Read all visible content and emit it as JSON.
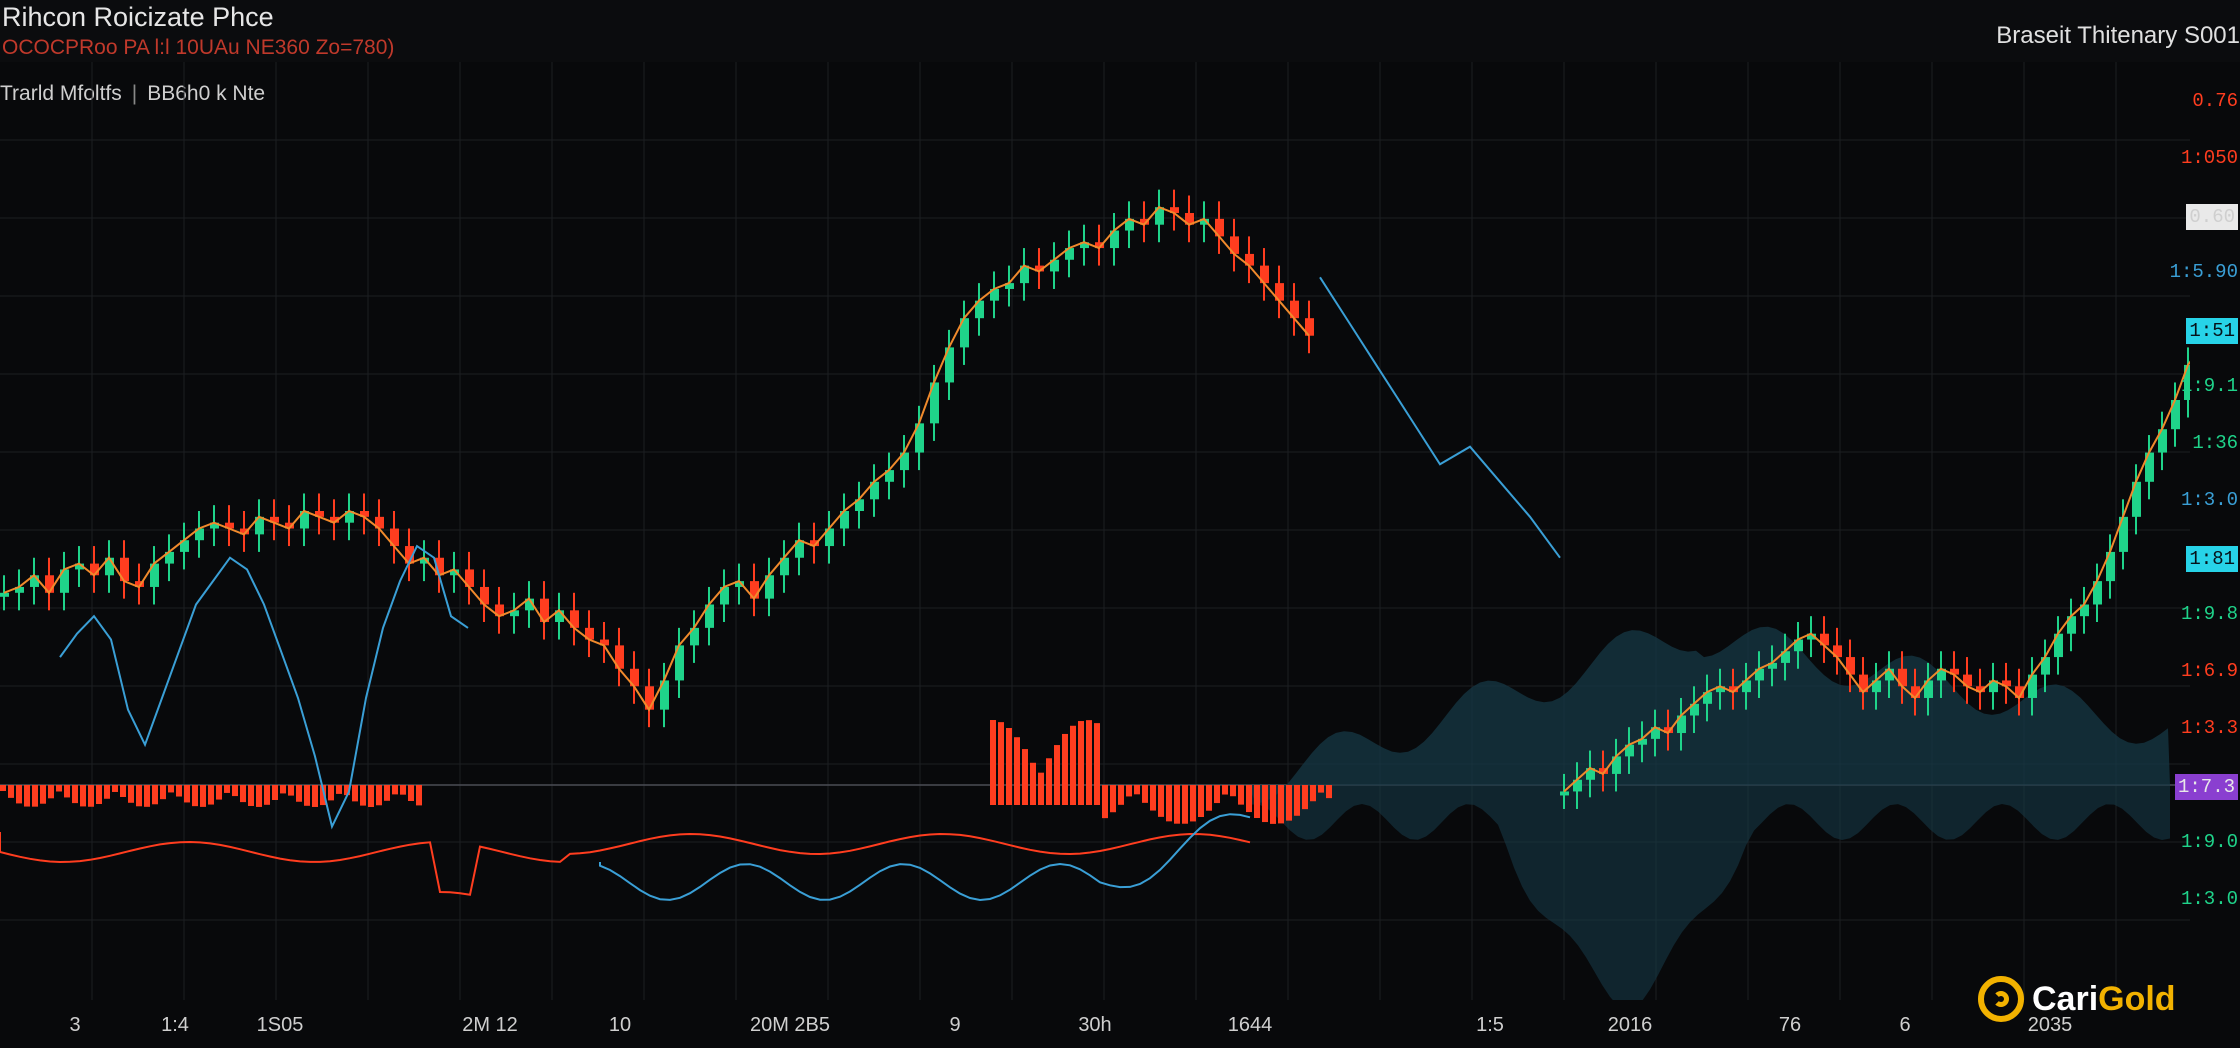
{
  "header": {
    "title": "Rihcon Roicizate Phce",
    "subtitle": "OCOCPRoo  PA l:l 10UAu  NE360 Zo=780)",
    "broker": "Braseit Thitenary S001"
  },
  "legend": {
    "left": "Trarld Mfoltfs",
    "right": "BB6h0 k Nte"
  },
  "colors": {
    "bull": "#1fd38a",
    "bear": "#ff3d1f",
    "line": "#3a9fd6",
    "area_fill": "#163846",
    "ma": "#f08a2c",
    "grid": "#1c1e22",
    "badge_cyan": "#27d3e8",
    "badge_purple": "#8a3fd0"
  },
  "y_axis": {
    "ticks": [
      {
        "label": "0.76",
        "color": "#ff3d1f",
        "badge": false
      },
      {
        "label": "1:050",
        "color": "#ff3d1f",
        "badge": false
      },
      {
        "label": "0.60",
        "color": "#cfcfcf",
        "badge": true,
        "badge_color": "#e9e9e9"
      },
      {
        "label": "1:5.90",
        "color": "#3a9fd6",
        "badge": false
      },
      {
        "label": "1:51",
        "color": "#06121a",
        "badge": true,
        "badge_color": "#27d3e8"
      },
      {
        "label": "1:9.1",
        "color": "#1fd38a",
        "badge": false
      },
      {
        "label": "1:36",
        "color": "#1fd38a",
        "badge": false
      },
      {
        "label": "1:3.0",
        "color": "#3a9fd6",
        "badge": false
      },
      {
        "label": "1:81",
        "color": "#06121a",
        "badge": true,
        "badge_color": "#27d3e8"
      },
      {
        "label": "1:9.8",
        "color": "#1fd38a",
        "badge": false
      },
      {
        "label": "1:6.9",
        "color": "#ff3d1f",
        "badge": false
      },
      {
        "label": "1:3.3",
        "color": "#ff3d1f",
        "badge": false
      },
      {
        "label": "1:7.3",
        "color": "#e8e8e8",
        "badge": true,
        "badge_color": "#8a3fd0"
      },
      {
        "label": "1:9.0",
        "color": "#1fd38a",
        "badge": false
      },
      {
        "label": "1:3.0",
        "color": "#1fd38a",
        "badge": false
      }
    ]
  },
  "x_axis": {
    "ticks": [
      "3",
      "1:4",
      "1S05",
      "2M 12",
      "10",
      "20M 2B5",
      "9",
      "30h",
      "1644",
      "1:5",
      "2016",
      "76",
      "6",
      "2035"
    ]
  },
  "logo": {
    "brand_a": "Cari",
    "brand_b": "Gold"
  },
  "chart_data": {
    "type": "candlestick",
    "title": "Rihcon Roicizate Phce",
    "series": [
      {
        "kind": "candles",
        "close": [
          1.16,
          1.17,
          1.19,
          1.16,
          1.2,
          1.21,
          1.19,
          1.22,
          1.18,
          1.17,
          1.21,
          1.23,
          1.25,
          1.27,
          1.28,
          1.27,
          1.26,
          1.29,
          1.28,
          1.27,
          1.3,
          1.29,
          1.28,
          1.3,
          1.29,
          1.27,
          1.24,
          1.21,
          1.22,
          1.19,
          1.2,
          1.17,
          1.14,
          1.12,
          1.13,
          1.15,
          1.11,
          1.13,
          1.1,
          1.08,
          1.07,
          1.03,
          1.0,
          0.96,
          1.01,
          1.07,
          1.1,
          1.14,
          1.17,
          1.18,
          1.15,
          1.19,
          1.22,
          1.25,
          1.24,
          1.27,
          1.3,
          1.32,
          1.35,
          1.37,
          1.4,
          1.45,
          1.52,
          1.58,
          1.63,
          1.66,
          1.68,
          1.69,
          1.72,
          1.71,
          1.73,
          1.75,
          1.76,
          1.75,
          1.78,
          1.8,
          1.79,
          1.82,
          1.81,
          1.79,
          1.8,
          1.77,
          1.74,
          1.72,
          1.69,
          1.66,
          1.63,
          1.6
        ]
      },
      {
        "kind": "candles",
        "close": [
          0.82,
          0.84,
          0.86,
          0.85,
          0.88,
          0.9,
          0.91,
          0.93,
          0.92,
          0.95,
          0.97,
          0.99,
          1.0,
          0.99,
          1.01,
          1.03,
          1.04,
          1.06,
          1.08,
          1.09,
          1.07,
          1.05,
          1.02,
          0.99,
          1.01,
          1.03,
          1.0,
          0.98,
          1.01,
          1.03,
          1.02,
          1.0,
          0.99,
          1.01,
          1.0,
          0.98,
          1.02,
          1.05,
          1.09,
          1.12,
          1.14,
          1.18,
          1.23,
          1.29,
          1.35,
          1.4,
          1.44,
          1.49,
          1.55,
          1.58,
          1.63
        ]
      },
      {
        "kind": "line",
        "values": [
          1.05,
          1.09,
          1.12,
          1.08,
          0.96,
          0.9,
          0.98,
          1.06,
          1.14,
          1.18,
          1.22,
          1.2,
          1.14,
          1.06,
          0.98,
          0.88,
          0.76,
          0.82,
          0.98,
          1.1,
          1.18,
          1.24,
          1.22,
          1.12,
          1.1
        ]
      },
      {
        "kind": "line",
        "values": [
          1.7,
          1.62,
          1.54,
          1.46,
          1.38,
          1.41,
          1.35,
          1.29,
          1.22
        ]
      }
    ]
  }
}
